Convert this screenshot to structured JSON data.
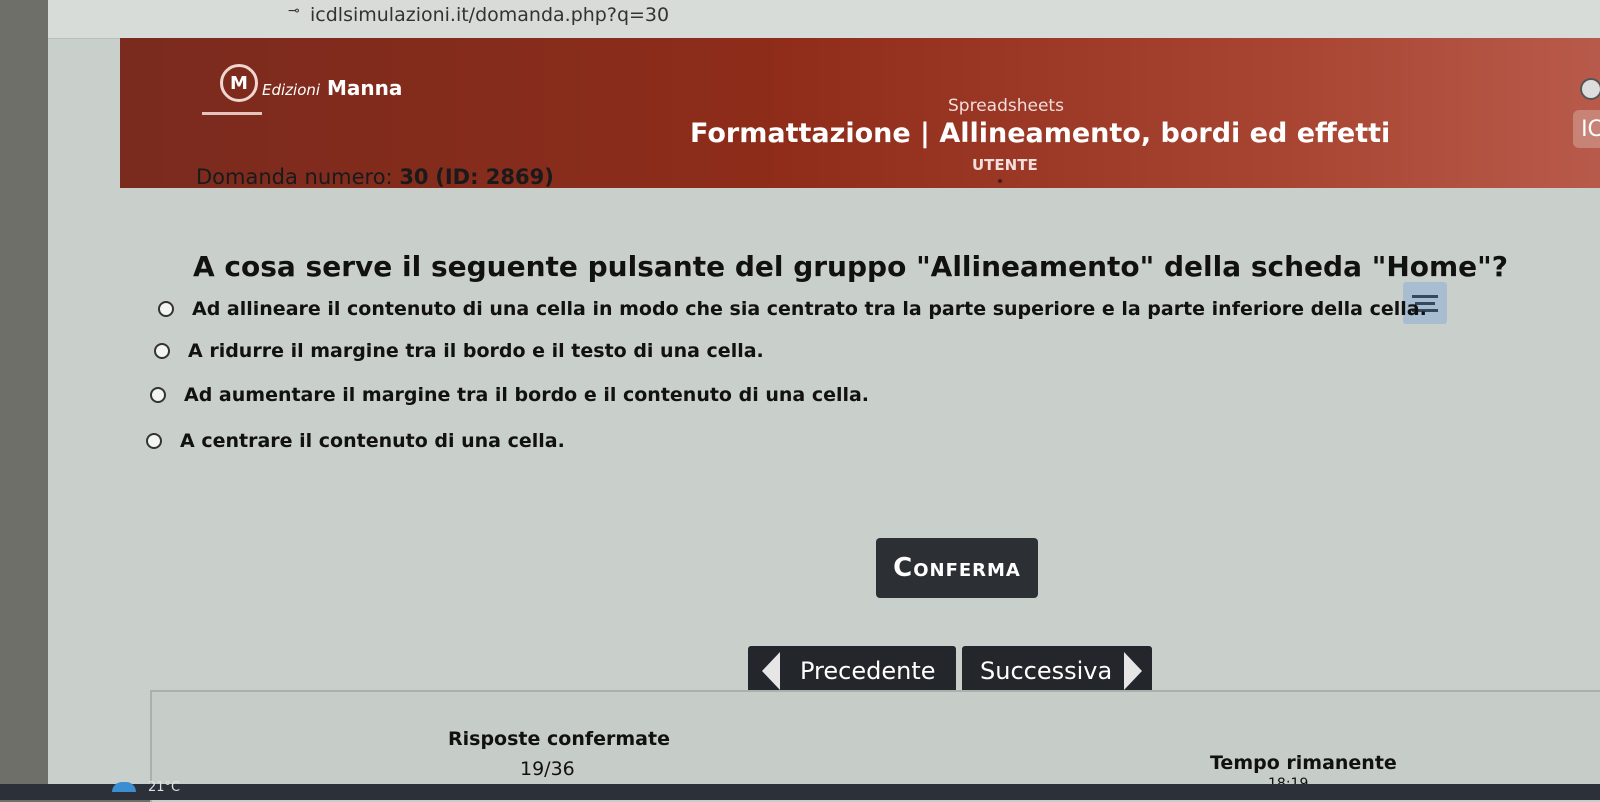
{
  "browser": {
    "url": "icdlsimulazioni.it/domanda.php?q=30"
  },
  "header": {
    "brand_italic": "Edizioni",
    "brand_bold": "Manna",
    "logo_letter": "M",
    "subject": "Spreadsheets",
    "section_title": "Formattazione | Allineamento, bordi ed effetti",
    "user_label": "UTENTE",
    "corner_label": "IC"
  },
  "question": {
    "number_prefix": "Domanda numero:",
    "number": "30",
    "id_text": "(ID: 2869)",
    "text": "A cosa serve il seguente pulsante del gruppo \"Allineamento\" della scheda \"Home\"?",
    "icon": "align-middle-icon"
  },
  "options": [
    "Ad allineare il contenuto di una cella in modo che sia centrato tra la parte superiore e la parte inferiore della cella.",
    "A ridurre il margine tra il bordo e il testo di una cella.",
    "Ad aumentare il margine tra il bordo e il contenuto di una cella.",
    "A centrare il contenuto di una cella."
  ],
  "buttons": {
    "confirm": "Conferma",
    "previous": "Precedente",
    "next": "Successiva"
  },
  "stats": {
    "confirmed_label": "Risposte confermate",
    "confirmed_value": "19/36",
    "time_label": "Tempo rimanente",
    "time_value": "18:19"
  },
  "taskbar": {
    "temperature": "21°C"
  },
  "colors": {
    "header_start": "#7a2b1e",
    "header_end": "#b85a4b",
    "button_dark": "#2c2f33",
    "page_bg": "#c9cfca"
  }
}
